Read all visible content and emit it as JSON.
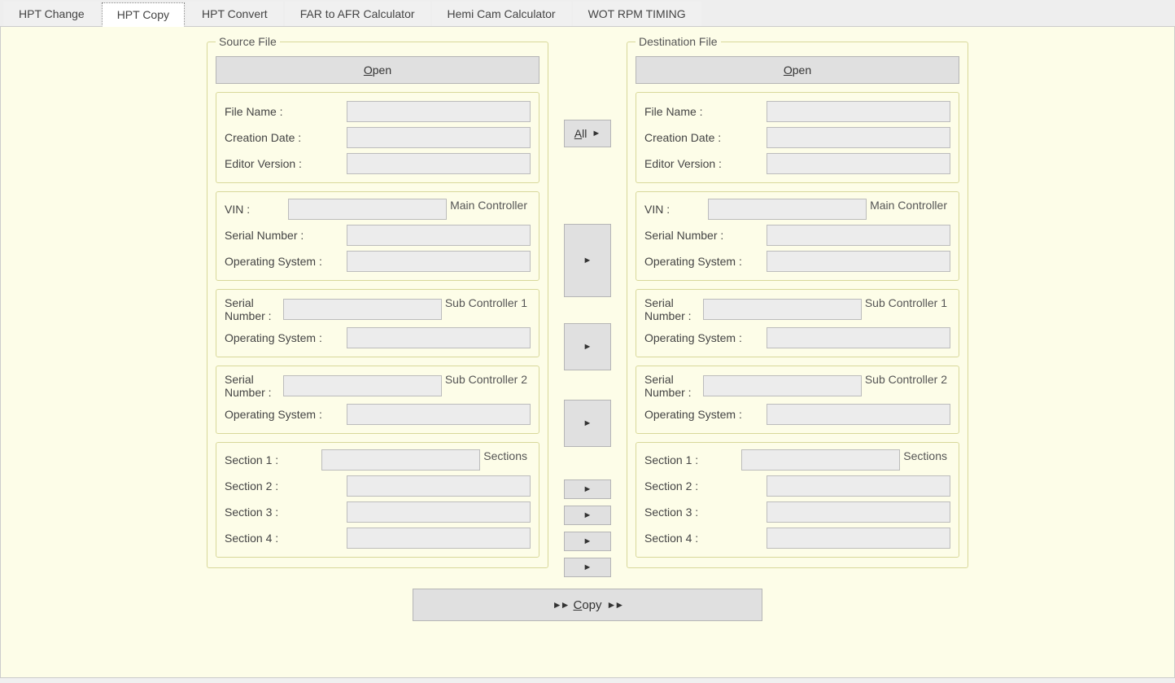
{
  "tabs": [
    {
      "label": "HPT Change"
    },
    {
      "label": "HPT Copy"
    },
    {
      "label": "HPT Convert"
    },
    {
      "label": "FAR to AFR Calculator"
    },
    {
      "label": "Hemi Cam Calculator"
    },
    {
      "label": "WOT RPM TIMING"
    }
  ],
  "active_tab_index": 1,
  "buttons": {
    "open": "Open",
    "all": "All",
    "copy": "Copy"
  },
  "labels": {
    "file_name": "File Name :",
    "creation_date": "Creation Date :",
    "editor_version": "Editor Version :",
    "vin": "VIN :",
    "serial_number": "Serial Number :",
    "operating_system": "Operating System :",
    "section1": "Section 1 :",
    "section2": "Section 2 :",
    "section3": "Section 3 :",
    "section4": "Section 4 :"
  },
  "group_titles": {
    "source": "Source File",
    "destination": "Destination File",
    "main_controller": "Main Controller",
    "sub_controller_1": "Sub Controller 1",
    "sub_controller_2": "Sub Controller 2",
    "sections": "Sections"
  },
  "source": {
    "file_name": "",
    "creation_date": "",
    "editor_version": "",
    "main": {
      "vin": "",
      "serial": "",
      "os": ""
    },
    "sub1": {
      "serial": "",
      "os": ""
    },
    "sub2": {
      "serial": "",
      "os": ""
    },
    "sections": {
      "s1": "",
      "s2": "",
      "s3": "",
      "s4": ""
    }
  },
  "destination": {
    "file_name": "",
    "creation_date": "",
    "editor_version": "",
    "main": {
      "vin": "",
      "serial": "",
      "os": ""
    },
    "sub1": {
      "serial": "",
      "os": ""
    },
    "sub2": {
      "serial": "",
      "os": ""
    },
    "sections": {
      "s1": "",
      "s2": "",
      "s3": "",
      "s4": ""
    }
  }
}
